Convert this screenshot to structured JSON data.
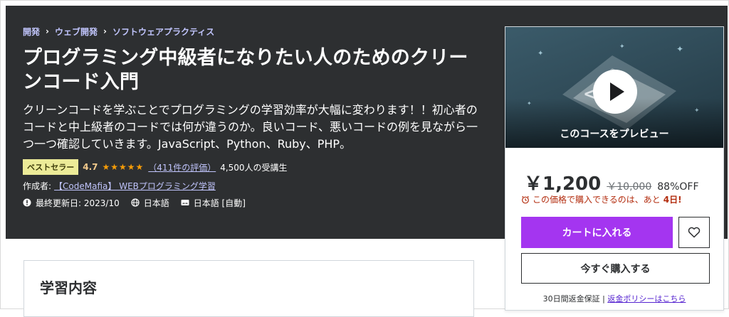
{
  "breadcrumb": {
    "items": [
      "開発",
      "ウェブ開発",
      "ソフトウェアプラクティス"
    ],
    "separator": "›"
  },
  "course": {
    "title": "プログラミング中級者になりたい人のためのクリーンコード入門",
    "subtitle": "クリーンコードを学ぶことでプログラミングの学習効率が大幅に変わります！！初心者のコードと中上級者のコードでは何が違うのか。良いコード、悪いコードの例を見ながら一つ一つ確認していきます。JavaScript、Python、Ruby、PHP。",
    "badge": "ベストセラー",
    "rating": "4.7",
    "stars": "★★★★★",
    "rating_count": "（411件の評価）",
    "students": "4,500人の受講生",
    "author_label": "作成者:",
    "author": "【CodeMafia】 WEBプログラミング学習",
    "updated": "最終更新日: 2023/10",
    "language": "日本語",
    "captions": "日本語 [自動]"
  },
  "sidebar": {
    "preview_label": "このコースをプレビュー",
    "price": "￥1,200",
    "original_price": "￥10,000",
    "discount": "88%OFF",
    "timer_prefix": "この価格で購入できるのは、あと",
    "timer_days": "4日!",
    "cart_button": "カートに入れる",
    "buy_button": "今すぐ購入する",
    "guarantee": "30日間返金保証 | ",
    "refund_link": "返金ポリシーはこちら"
  },
  "learn": {
    "title": "学習内容"
  },
  "colors": {
    "hero_bg": "#2d2f31",
    "accent": "#a435f0",
    "badge_bg": "#eceb98",
    "rating": "#f3ca8c",
    "timer": "#b32d0f"
  }
}
